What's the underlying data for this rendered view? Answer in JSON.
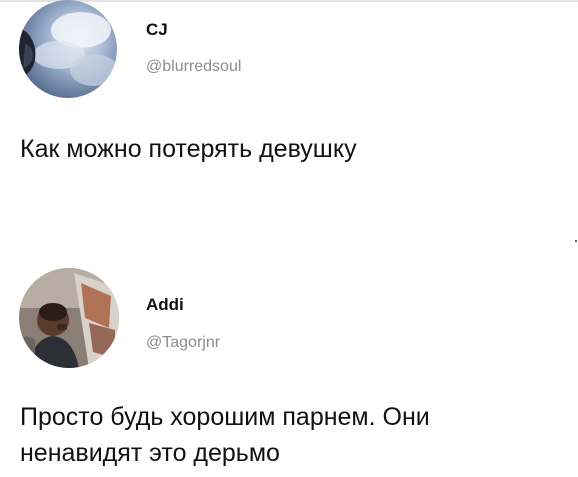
{
  "tweets": [
    {
      "display_name": "CJ",
      "handle": "@blurredsoul",
      "text": "Как можно потерять девушку"
    },
    {
      "display_name": "Addi",
      "handle": "@Tagorjnr",
      "text_lines": [
        "Просто будь хорошим парнем. Они",
        "ненавидят это дерьмо"
      ]
    }
  ],
  "colors": {
    "background": "#ffffff",
    "text": "#111111",
    "handle": "#8c8c8c"
  }
}
